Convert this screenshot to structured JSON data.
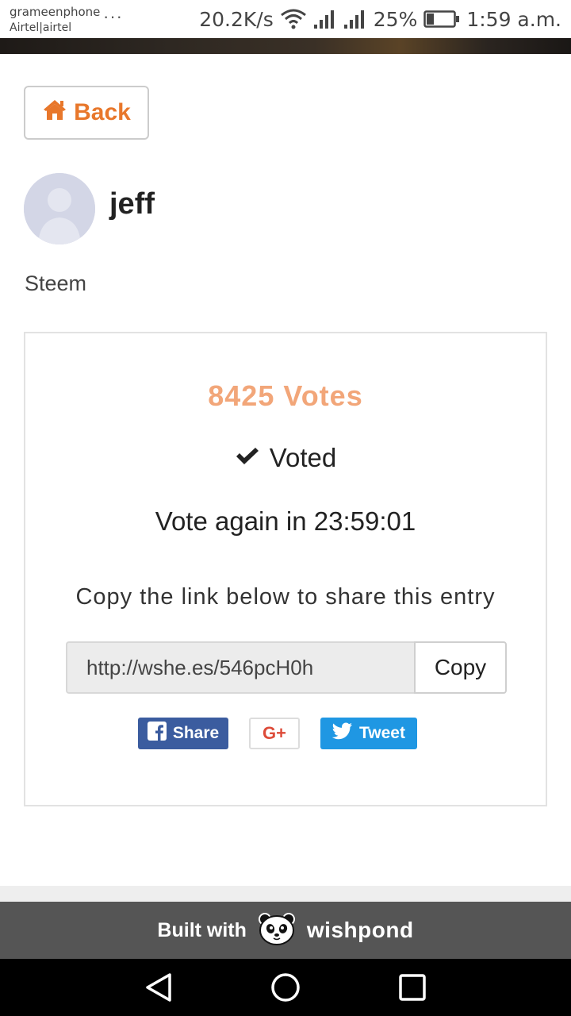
{
  "status_bar": {
    "carrier_1": "grameenphone",
    "carrier_2": "Airtel|airtel",
    "overflow": "···",
    "speed": "20.2K/s",
    "battery": "25%",
    "time": "1:59 a.m."
  },
  "back": {
    "label": "Back"
  },
  "profile": {
    "name": "jeff"
  },
  "entry": {
    "text": "Steem"
  },
  "vote_card": {
    "votes": "8425 Votes",
    "voted": "Voted",
    "vote_again": "Vote again in 23:59:01",
    "share_note": "Copy the link below to share this entry",
    "link_value": "http://wshe.es/546pcH0h",
    "copy_label": "Copy",
    "share_label": "Share",
    "gplus_label": "G+",
    "tweet_label": "Tweet"
  },
  "footer": {
    "built_with": "Built with",
    "brand": "wishpond"
  },
  "colors": {
    "accent": "#e8772b",
    "votes": "#f2a679",
    "facebook": "#3b5c9f",
    "twitter": "#1f97e3",
    "gplus": "#dd4b39",
    "footer_bg": "#555555"
  },
  "icons": [
    "wifi-icon",
    "signal-icon",
    "battery-icon",
    "home-icon",
    "check-icon",
    "facebook-icon",
    "twitter-icon",
    "panda-icon",
    "nav-back-icon",
    "nav-home-icon",
    "nav-recents-icon"
  ]
}
